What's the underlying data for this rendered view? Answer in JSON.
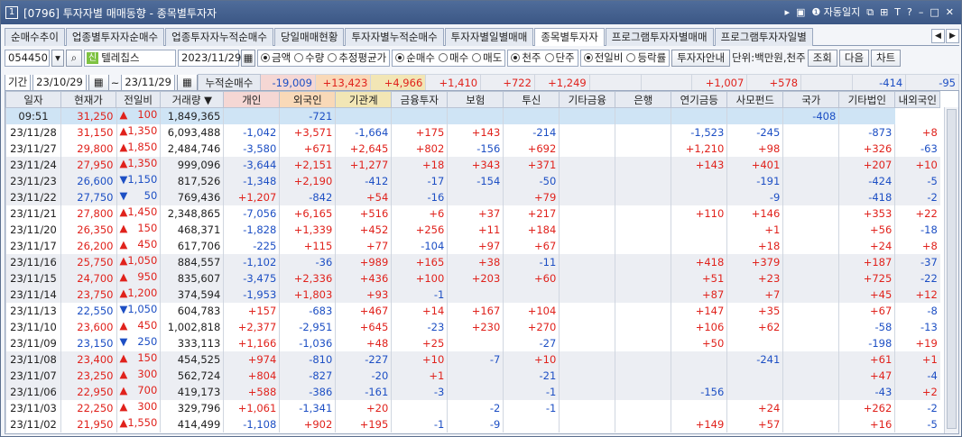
{
  "window": {
    "num": "1",
    "title": "[0796] 투자자별 매매동향 - 종목별투자자",
    "right_items": [
      "▸",
      "▣",
      "❶ 자동일지",
      "⧉",
      "⊞",
      "T",
      "?",
      "–",
      "□",
      "✕"
    ]
  },
  "tabs": [
    "순매수추이",
    "업종별투자자순매수",
    "업종투자자누적순매수",
    "당일매매현황",
    "투자자별누적순매수",
    "투자자별일별매매",
    "종목별투자자",
    "프로그램투자자별매매",
    "프로그램투자자일별"
  ],
  "active_tab": 6,
  "toolbar": {
    "code": "054450",
    "badge": "신",
    "name": "텔레칩스",
    "date": "2023/11/29",
    "r1": [
      {
        "l": "금액",
        "on": true
      },
      {
        "l": "수량",
        "on": false
      },
      {
        "l": "추정평균가",
        "on": false
      }
    ],
    "r2": [
      {
        "l": "순매수",
        "on": true
      },
      {
        "l": "매수",
        "on": false
      },
      {
        "l": "매도",
        "on": false
      }
    ],
    "r3": [
      {
        "l": "천주",
        "on": true
      },
      {
        "l": "단주",
        "on": false
      }
    ],
    "r4": [
      {
        "l": "전일비",
        "on": true
      },
      {
        "l": "등락률",
        "on": false
      }
    ],
    "btn_info": "투자자안내",
    "unit": "단위:백만원,천주",
    "btn_query": "조회",
    "btn_next": "다음",
    "btn_chart": "차트"
  },
  "period": {
    "label": "기간",
    "from": "23/10/29",
    "to": "23/11/29",
    "cum_label": "누적순매수",
    "cum": [
      "-19,009",
      "+13,423",
      "+4,966",
      "+1,410",
      "+722",
      "+1,249",
      "",
      "",
      "+1,007",
      "+578",
      "",
      "-414",
      "-95"
    ]
  },
  "headers": [
    "일자",
    "현재가",
    "전일비",
    "거래량",
    "개인",
    "외국인",
    "기관계",
    "금융투자",
    "보험",
    "투신",
    "기타금융",
    "은행",
    "연기금등",
    "사모펀드",
    "국가",
    "기타법인",
    "내외국인"
  ],
  "rows": [
    [
      "09:51",
      "31,250",
      "▲",
      "100",
      "1,849,365",
      "",
      "-721",
      "",
      "",
      "",
      "",
      "",
      "",
      "",
      "",
      "-408",
      ""
    ],
    [
      "23/11/28",
      "31,150",
      "▲",
      "1,350",
      "6,093,488",
      "-1,042",
      "+3,571",
      "-1,664",
      "+175",
      "+143",
      "-214",
      "",
      "",
      "-1,523",
      "-245",
      "",
      "-873",
      "+8"
    ],
    [
      "23/11/27",
      "29,800",
      "▲",
      "1,850",
      "2,484,746",
      "-3,580",
      "+671",
      "+2,645",
      "+802",
      "-156",
      "+692",
      "",
      "",
      "+1,210",
      "+98",
      "",
      "+326",
      "-63"
    ],
    [
      "23/11/24",
      "27,950",
      "▲",
      "1,350",
      "999,096",
      "-3,644",
      "+2,151",
      "+1,277",
      "+18",
      "+343",
      "+371",
      "",
      "",
      "+143",
      "+401",
      "",
      "+207",
      "+10"
    ],
    [
      "23/11/23",
      "26,600",
      "▼",
      "1,150",
      "817,526",
      "-1,348",
      "+2,190",
      "-412",
      "-17",
      "-154",
      "-50",
      "",
      "",
      "",
      "-191",
      "",
      "-424",
      "-5"
    ],
    [
      "23/11/22",
      "27,750",
      "▼",
      "50",
      "769,436",
      "+1,207",
      "-842",
      "+54",
      "-16",
      "",
      "+79",
      "",
      "",
      "",
      "-9",
      "",
      "-418",
      "-2"
    ],
    [
      "23/11/21",
      "27,800",
      "▲",
      "1,450",
      "2,348,865",
      "-7,056",
      "+6,165",
      "+516",
      "+6",
      "+37",
      "+217",
      "",
      "",
      "+110",
      "+146",
      "",
      "+353",
      "+22"
    ],
    [
      "23/11/20",
      "26,350",
      "▲",
      "150",
      "468,371",
      "-1,828",
      "+1,339",
      "+452",
      "+256",
      "+11",
      "+184",
      "",
      "",
      "",
      "+1",
      "",
      "+56",
      "-18"
    ],
    [
      "23/11/17",
      "26,200",
      "▲",
      "450",
      "617,706",
      "-225",
      "+115",
      "+77",
      "-104",
      "+97",
      "+67",
      "",
      "",
      "",
      "+18",
      "",
      "+24",
      "+8"
    ],
    [
      "23/11/16",
      "25,750",
      "▲",
      "1,050",
      "884,557",
      "-1,102",
      "-36",
      "+989",
      "+165",
      "+38",
      "-11",
      "",
      "",
      "+418",
      "+379",
      "",
      "+187",
      "-37"
    ],
    [
      "23/11/15",
      "24,700",
      "▲",
      "950",
      "835,607",
      "-3,475",
      "+2,336",
      "+436",
      "+100",
      "+203",
      "+60",
      "",
      "",
      "+51",
      "+23",
      "",
      "+725",
      "-22"
    ],
    [
      "23/11/14",
      "23,750",
      "▲",
      "1,200",
      "374,594",
      "-1,953",
      "+1,803",
      "+93",
      "-1",
      "",
      "",
      "",
      "",
      "+87",
      "+7",
      "",
      "+45",
      "+12"
    ],
    [
      "23/11/13",
      "22,550",
      "▼",
      "1,050",
      "604,783",
      "+157",
      "-683",
      "+467",
      "+14",
      "+167",
      "+104",
      "",
      "",
      "+147",
      "+35",
      "",
      "+67",
      "-8"
    ],
    [
      "23/11/10",
      "23,600",
      "▲",
      "450",
      "1,002,818",
      "+2,377",
      "-2,951",
      "+645",
      "-23",
      "+230",
      "+270",
      "",
      "",
      "+106",
      "+62",
      "",
      "-58",
      "-13"
    ],
    [
      "23/11/09",
      "23,150",
      "▼",
      "250",
      "333,113",
      "+1,166",
      "-1,036",
      "+48",
      "+25",
      "",
      "-27",
      "",
      "",
      "+50",
      "",
      "",
      "-198",
      "+19"
    ],
    [
      "23/11/08",
      "23,400",
      "▲",
      "150",
      "454,525",
      "+974",
      "-810",
      "-227",
      "+10",
      "-7",
      "+10",
      "",
      "",
      "",
      "-241",
      "",
      "+61",
      "+1"
    ],
    [
      "23/11/07",
      "23,250",
      "▲",
      "300",
      "562,724",
      "+804",
      "-827",
      "-20",
      "+1",
      "",
      "-21",
      "",
      "",
      "",
      "",
      "",
      "+47",
      "-4"
    ],
    [
      "23/11/06",
      "22,950",
      "▲",
      "700",
      "419,173",
      "+588",
      "-386",
      "-161",
      "-3",
      "",
      "-1",
      "",
      "",
      "-156",
      "",
      "",
      "-43",
      "+2"
    ],
    [
      "23/11/03",
      "22,250",
      "▲",
      "300",
      "329,796",
      "+1,061",
      "-1,341",
      "+20",
      "",
      "-2",
      "-1",
      "",
      "",
      "",
      "+24",
      "",
      "+262",
      "-2"
    ],
    [
      "23/11/02",
      "21,950",
      "▲",
      "1,550",
      "414,499",
      "-1,108",
      "+902",
      "+195",
      "-1",
      "-9",
      "",
      "",
      "",
      "+149",
      "+57",
      "",
      "+16",
      "-5"
    ]
  ]
}
